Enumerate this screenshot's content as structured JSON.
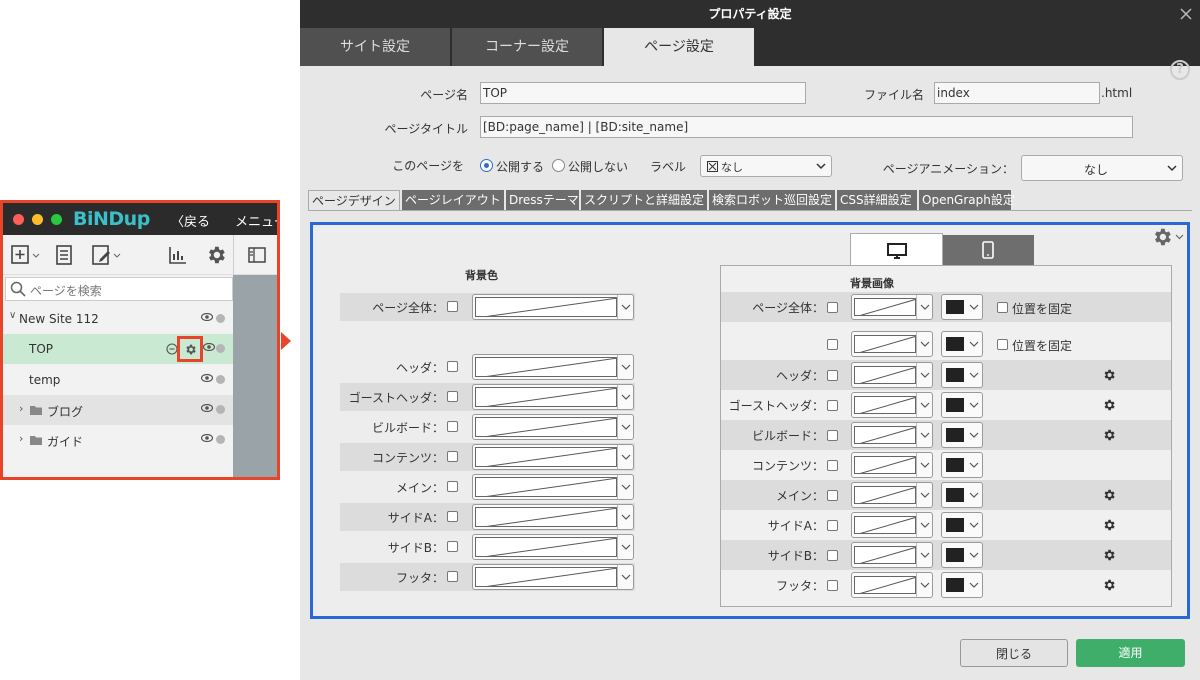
{
  "left_panel": {
    "logo": "BiNDup",
    "back": "戻る",
    "menu": "メニュー",
    "search_placeholder": "ページを検索",
    "tree": [
      {
        "label": "New Site 112"
      },
      {
        "label": "TOP"
      },
      {
        "label": "temp"
      },
      {
        "label": "ブログ"
      },
      {
        "label": "ガイド"
      }
    ]
  },
  "dialog": {
    "title": "プロパティ設定",
    "tabs": [
      {
        "label": "サイト設定"
      },
      {
        "label": "コーナー設定"
      },
      {
        "label": "ページ設定"
      }
    ],
    "help": "?",
    "fields": {
      "page_name_label": "ページ名",
      "page_name_value": "TOP",
      "file_name_label": "ファイル名",
      "file_name_value": "index",
      "file_ext": ".html",
      "page_title_label": "ページタイトル",
      "page_title_value": "[BD:page_name] | [BD:site_name]",
      "publish_label": "このページを",
      "publish_on": "公開する",
      "publish_off": "公開しない",
      "label_label": "ラベル",
      "label_value": "なし",
      "anim_label": "ページアニメーション：",
      "anim_value": "なし"
    },
    "subtabs": [
      {
        "label": "ページデザイン"
      },
      {
        "label": "ページレイアウト"
      },
      {
        "label": "Dressテーマ"
      },
      {
        "label": "スクリプトと詳細設定"
      },
      {
        "label": "検索ロボット巡回設定"
      },
      {
        "label": "CSS詳細設定"
      },
      {
        "label": "OpenGraph設定"
      }
    ],
    "design": {
      "bg_color_title": "背景色",
      "bg_image_title": "背景画像",
      "fix_position": "位置を固定",
      "color_rows": [
        {
          "label": "ページ全体："
        },
        {
          "label": "ヘッダ："
        },
        {
          "label": "ゴーストヘッダ："
        },
        {
          "label": "ビルボード："
        },
        {
          "label": "コンテンツ："
        },
        {
          "label": "メイン："
        },
        {
          "label": "サイドA："
        },
        {
          "label": "サイドB："
        },
        {
          "label": "フッタ："
        }
      ],
      "image_rows": [
        {
          "label": "ページ全体："
        },
        {
          "label": ""
        },
        {
          "label": "ヘッダ："
        },
        {
          "label": "ゴーストヘッダ："
        },
        {
          "label": "ビルボード："
        },
        {
          "label": "コンテンツ："
        },
        {
          "label": "メイン："
        },
        {
          "label": "サイドA："
        },
        {
          "label": "サイドB："
        },
        {
          "label": "フッタ："
        }
      ]
    },
    "buttons": {
      "close": "閉じる",
      "apply": "適用"
    },
    "colors": {
      "accent_blue": "#2a67d7",
      "apply_green": "#3fae6a",
      "highlight_red": "#e8442a"
    }
  }
}
